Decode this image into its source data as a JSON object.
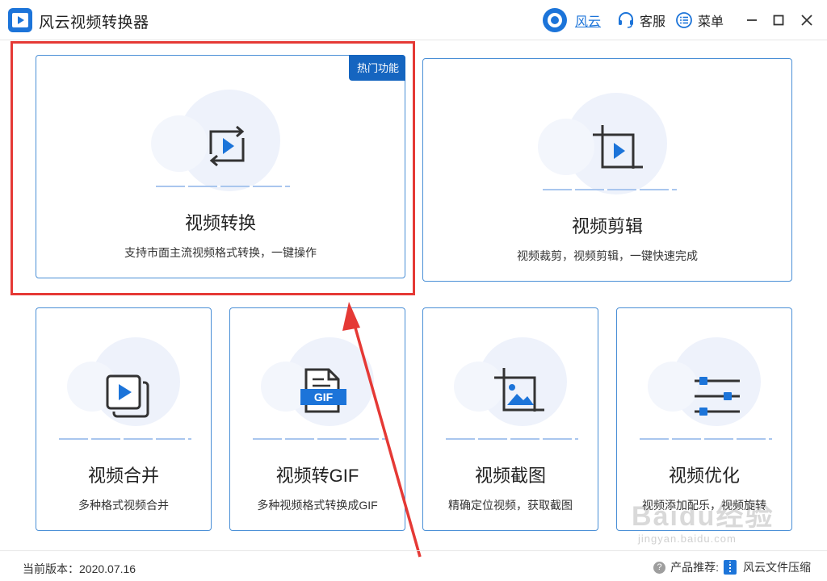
{
  "app": {
    "title": "风云视频转换器"
  },
  "header": {
    "fengyun_label": "风云",
    "service_label": "客服",
    "menu_label": "菜单"
  },
  "cards": {
    "convert": {
      "title": "视频转换",
      "desc": "支持市面主流视频格式转换，一键操作",
      "badge": "热门功能",
      "icon": "convert-play-icon"
    },
    "edit": {
      "title": "视频剪辑",
      "desc": "视频裁剪，视频剪辑，一键快速完成",
      "icon": "crop-play-icon"
    },
    "merge": {
      "title": "视频合并",
      "desc": "多种格式视频合并",
      "icon": "stacked-play-icon"
    },
    "gif": {
      "title": "视频转GIF",
      "desc": "多种视频格式转换成GIF",
      "icon": "gif-file-icon",
      "icon_text": "GIF"
    },
    "screenshot": {
      "title": "视频截图",
      "desc": "精确定位视频，获取截图",
      "icon": "crop-image-icon"
    },
    "optimize": {
      "title": "视频优化",
      "desc": "视频添加配乐，视频旋转",
      "icon": "sliders-icon"
    }
  },
  "footer": {
    "version": "当前版本：2020.07.16",
    "recommend_label": "产品推荐:",
    "recommend_product": "风云文件压缩"
  },
  "watermark": {
    "text": "Baidu经验",
    "sub": "jingyan.baidu.com"
  },
  "colors": {
    "accent": "#1c74d9",
    "badge": "#1565c0",
    "highlight": "#e53935",
    "card_border": "#4a8fd6"
  }
}
